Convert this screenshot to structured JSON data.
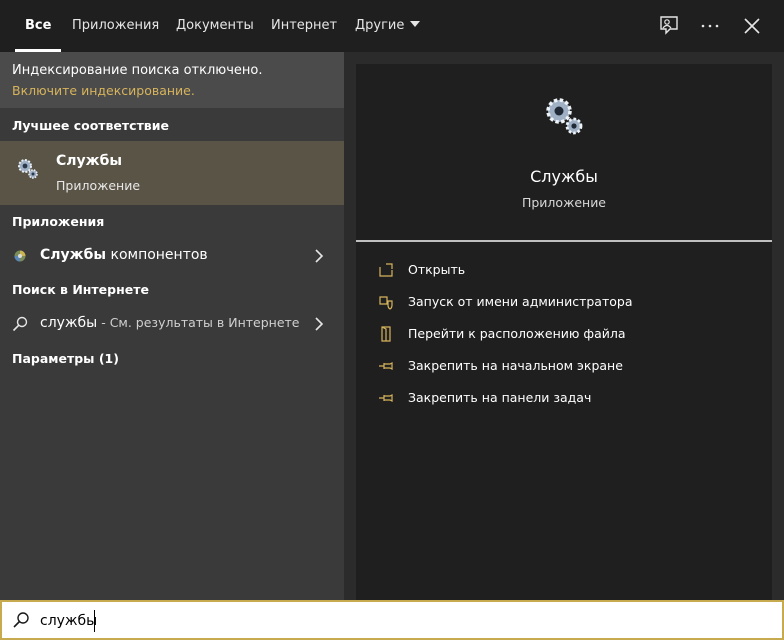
{
  "tabs": [
    {
      "label": "Все",
      "active": true
    },
    {
      "label": "Приложения"
    },
    {
      "label": "Документы"
    },
    {
      "label": "Интернет"
    },
    {
      "label": "Другие"
    }
  ],
  "toolbar_icons": [
    "feedback-icon",
    "more-icon",
    "close-icon"
  ],
  "left": {
    "index_notice": "Индексирование поиска отключено.",
    "index_link": "Включите индексирование.",
    "best_match_header": "Лучшее соответствие",
    "best_match": {
      "title": "Службы",
      "subtitle": "Приложение",
      "icon": "gears-icon"
    },
    "apps_header": "Приложения",
    "app_item": {
      "bold": "Службы",
      "rest": " компонентов"
    },
    "web_header": "Поиск в Интернете",
    "web_item": {
      "bold": "службы",
      "rest": " - См. результаты в Интернете"
    },
    "settings_header": "Параметры (1)"
  },
  "right": {
    "title": "Службы",
    "subtitle": "Приложение",
    "actions": [
      {
        "label": "Открыть",
        "icon": "open-icon"
      },
      {
        "label": "Запуск от имени администратора",
        "icon": "admin-shield-icon"
      },
      {
        "label": "Перейти к расположению файла",
        "icon": "file-location-icon"
      },
      {
        "label": "Закрепить на начальном экране",
        "icon": "pin-icon"
      },
      {
        "label": "Закрепить на панели задач",
        "icon": "pin-icon"
      }
    ]
  },
  "search": {
    "value": "службы"
  },
  "colors": {
    "accent": "#d7b45c",
    "selection": "#5a5446",
    "panel": "#3a3a3a",
    "preview": "#1f1f1f"
  }
}
